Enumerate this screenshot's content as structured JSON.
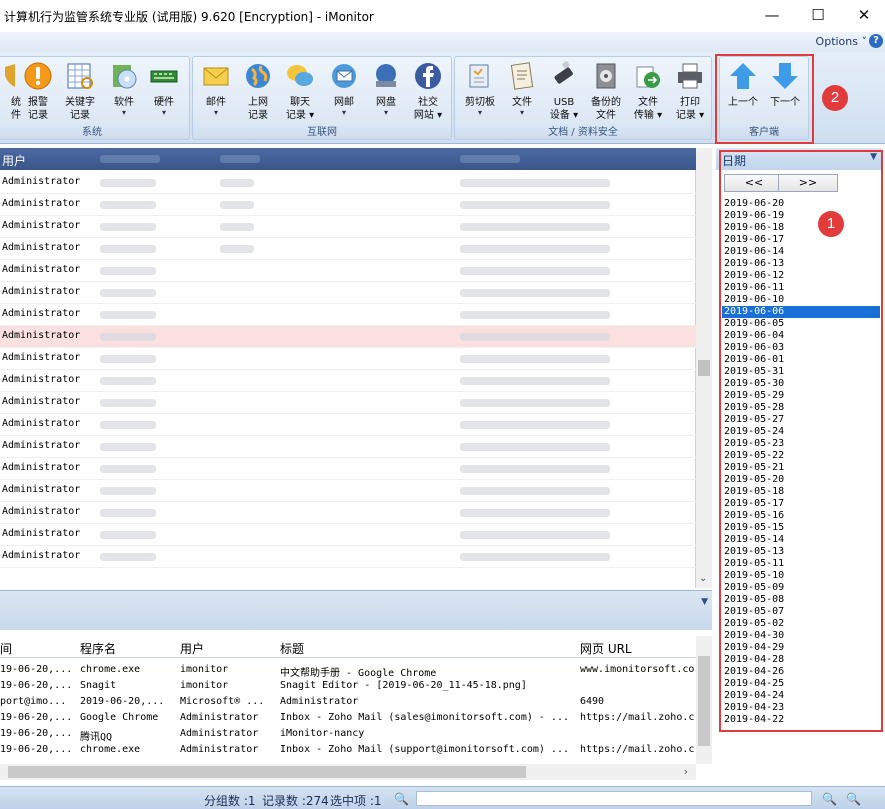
{
  "window": {
    "title": "计算机行为监管系统专业版 (试用版) 9.620 [Encryption] - iMonitor",
    "minimize": "—",
    "maximize": "☐",
    "close": "✕"
  },
  "options_bar": {
    "label": "Options",
    "help": "?"
  },
  "ribbon": {
    "groups": [
      {
        "label": "系统",
        "buttons": [
          {
            "label": "统\n件"
          },
          {
            "label": "报警\n记录",
            "icon": "alert-icon"
          },
          {
            "label": "关键字\n记录",
            "icon": "keyword-icon"
          },
          {
            "label": "软件",
            "icon": "software-icon"
          },
          {
            "label": "硬件",
            "icon": "hardware-icon"
          }
        ]
      },
      {
        "label": "互联网",
        "buttons": [
          {
            "label": "邮件",
            "icon": "mail-icon"
          },
          {
            "label": "上网\n记录",
            "icon": "web-icon"
          },
          {
            "label": "聊天\n记录",
            "icon": "chat-icon"
          },
          {
            "label": "网邮",
            "icon": "webmail-icon"
          },
          {
            "label": "网盘",
            "icon": "netdisk-icon"
          },
          {
            "label": "社交\n网站",
            "icon": "facebook-icon"
          }
        ]
      },
      {
        "label": "文档 / 资料安全",
        "buttons": [
          {
            "label": "剪切板",
            "icon": "clipboard-icon"
          },
          {
            "label": "文件",
            "icon": "file-icon"
          },
          {
            "label": "USB\n设备",
            "icon": "usb-icon"
          },
          {
            "label": "备份的\n文件",
            "icon": "backup-icon"
          },
          {
            "label": "文件\n传输",
            "icon": "transfer-icon"
          },
          {
            "label": "打印\n记录",
            "icon": "print-icon"
          }
        ]
      },
      {
        "label": "客户端",
        "buttons": [
          {
            "label": "上一个",
            "icon": "arrow-up-icon"
          },
          {
            "label": "下一个",
            "icon": "arrow-down-icon"
          }
        ]
      }
    ]
  },
  "grid": {
    "header": "用户",
    "rows": [
      "Administrator",
      "Administrator",
      "Administrator",
      "Administrator",
      "Administrator",
      "Administrator",
      "Administrator",
      "Administrator",
      "Administrator",
      "Administrator",
      "Administrator",
      "Administrator",
      "Administrator",
      "Administrator",
      "Administrator",
      "Administrator",
      "Administrator",
      "Administrator"
    ],
    "selected_row": 7
  },
  "bottom_list": {
    "columns": [
      "间",
      "程序名",
      "用户",
      "标题",
      "网页 URL"
    ],
    "rows": [
      [
        "19-06-20,...",
        "chrome.exe",
        "imonitor",
        "中文帮助手册 - Google Chrome",
        "www.imonitorsoft.co"
      ],
      [
        "19-06-20,...",
        "Snagit",
        "imonitor",
        "Snagit Editor - [2019-06-20_11-45-18.png]",
        ""
      ],
      [
        "port@imo...",
        "2019-06-20,...",
        "Microsoft® ...",
        "Administrator",
        "6490"
      ],
      [
        "19-06-20,...",
        "Google Chrome",
        "Administrator",
        "Inbox - Zoho Mail (sales@imonitorsoft.com) - ...",
        "https://mail.zoho.c"
      ],
      [
        "19-06-20,...",
        "腾讯QQ",
        "Administrator",
        " iMonitor-nancy",
        ""
      ],
      [
        "19-06-20,...",
        "chrome.exe",
        "Administrator",
        "Inbox - Zoho Mail (support@imonitorsoft.com) ...",
        "https://mail.zoho.c"
      ]
    ]
  },
  "date_panel": {
    "header": "日期",
    "prev": "<<",
    "next": ">>",
    "selected": "2019-06-06",
    "dates": [
      "2019-06-20",
      "2019-06-19",
      "2019-06-18",
      "2019-06-17",
      "2019-06-14",
      "2019-06-13",
      "2019-06-12",
      "2019-06-11",
      "2019-06-10",
      "2019-06-06",
      "2019-06-05",
      "2019-06-04",
      "2019-06-03",
      "2019-06-01",
      "2019-05-31",
      "2019-05-30",
      "2019-05-29",
      "2019-05-28",
      "2019-05-27",
      "2019-05-24",
      "2019-05-23",
      "2019-05-22",
      "2019-05-21",
      "2019-05-20",
      "2019-05-18",
      "2019-05-17",
      "2019-05-16",
      "2019-05-15",
      "2019-05-14",
      "2019-05-13",
      "2019-05-11",
      "2019-05-10",
      "2019-05-09",
      "2019-05-08",
      "2019-05-07",
      "2019-05-02",
      "2019-04-30",
      "2019-04-29",
      "2019-04-28",
      "2019-04-26",
      "2019-04-25",
      "2019-04-24",
      "2019-04-23",
      "2019-04-22"
    ]
  },
  "annotations": {
    "badge1": "1",
    "badge2": "2"
  },
  "status_bar": {
    "group_count": "分组数 :1",
    "record_count": "记录数 :274",
    "selected": "选中项 :1"
  },
  "colors": {
    "accent": "#1a6fd6",
    "highlight_red": "#e23b3b",
    "header_blue": "#3a568a"
  }
}
